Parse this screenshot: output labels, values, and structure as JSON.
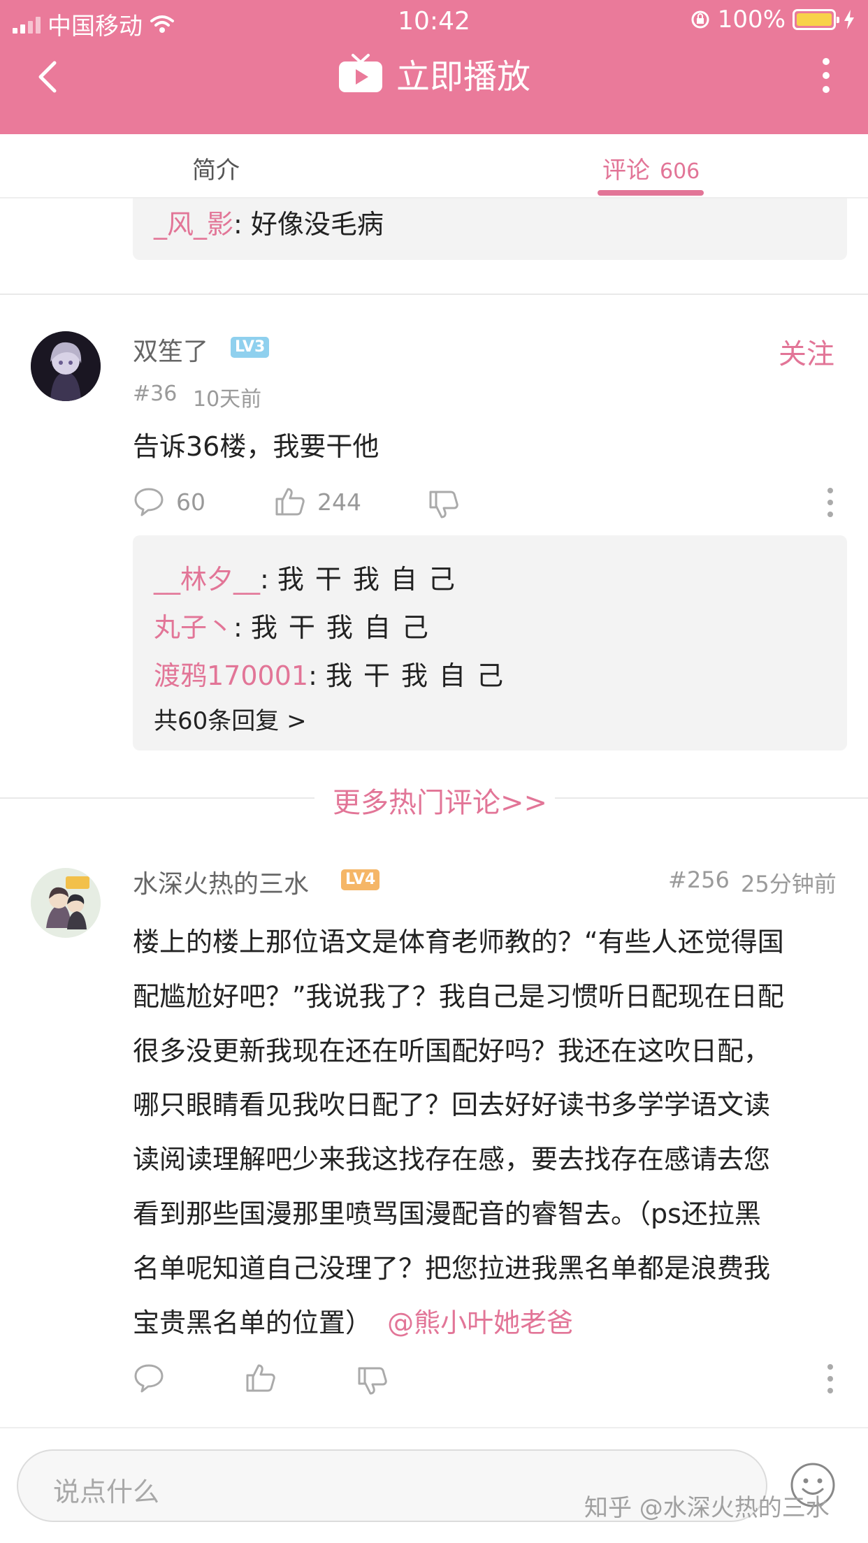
{
  "status_bar": {
    "carrier": "中国移动",
    "time": "10:42",
    "battery": "100%"
  },
  "header": {
    "title": "立即播放"
  },
  "tabs": [
    {
      "label": "简介"
    },
    {
      "label": "评论",
      "count": "606"
    }
  ],
  "prev_reply": {
    "user": "_风_影",
    "text": ": 好像没毛病"
  },
  "comment1": {
    "user": "双笙了",
    "level": "LV3",
    "follow": "关注",
    "floor": "#36",
    "time": "10天前",
    "text": "告诉36楼，我要干他",
    "reply_count": "60",
    "like_count": "244",
    "replies": [
      {
        "user": "__林夕__",
        "text": "我干我自己"
      },
      {
        "user": "丸子丶",
        "text": "我干我自己"
      },
      {
        "user": "渡鸦170001",
        "text": "我干我自己"
      }
    ],
    "more_replies": "共60条回复 >"
  },
  "more_hot": "更多热门评论>>",
  "comment2": {
    "user": "水深火热的三水",
    "level": "LV4",
    "floor": "#256",
    "time": "25分钟前",
    "lines": [
      "楼上的楼上那位语文是体育老师教的？“有些人还觉得国",
      "配尴尬好吧？”我说我了？我自己是习惯听日配现在日配",
      "很多没更新我现在还在听国配好吗？我还在这吹日配，",
      "哪只眼睛看见我吹日配了？回去好好读书多学学语文读",
      "读阅读理解吧少来我这找存在感，要去找存在感请去您",
      "看到那些国漫那里喷骂国漫配音的睿智去。（ps还拉黑",
      "名单呢知道自己没理了？把您拉进我黑名单都是浪费我"
    ],
    "last_line": "宝贵黑名单的位置）",
    "mention": "@熊小叶她老爸"
  },
  "input": {
    "placeholder": "说点什么"
  },
  "watermark": "知乎 @水深火热的三水",
  "colors": {
    "header": "#ea7a9a",
    "accent": "#e27597",
    "lv3": "#8fd0ee",
    "lv4": "#f5b667"
  },
  "icons": [
    "back-icon",
    "tv-icon",
    "more-icon",
    "comment-icon",
    "thumbs-up-icon",
    "thumbs-down-icon",
    "kebab-icon",
    "emoji-icon"
  ]
}
